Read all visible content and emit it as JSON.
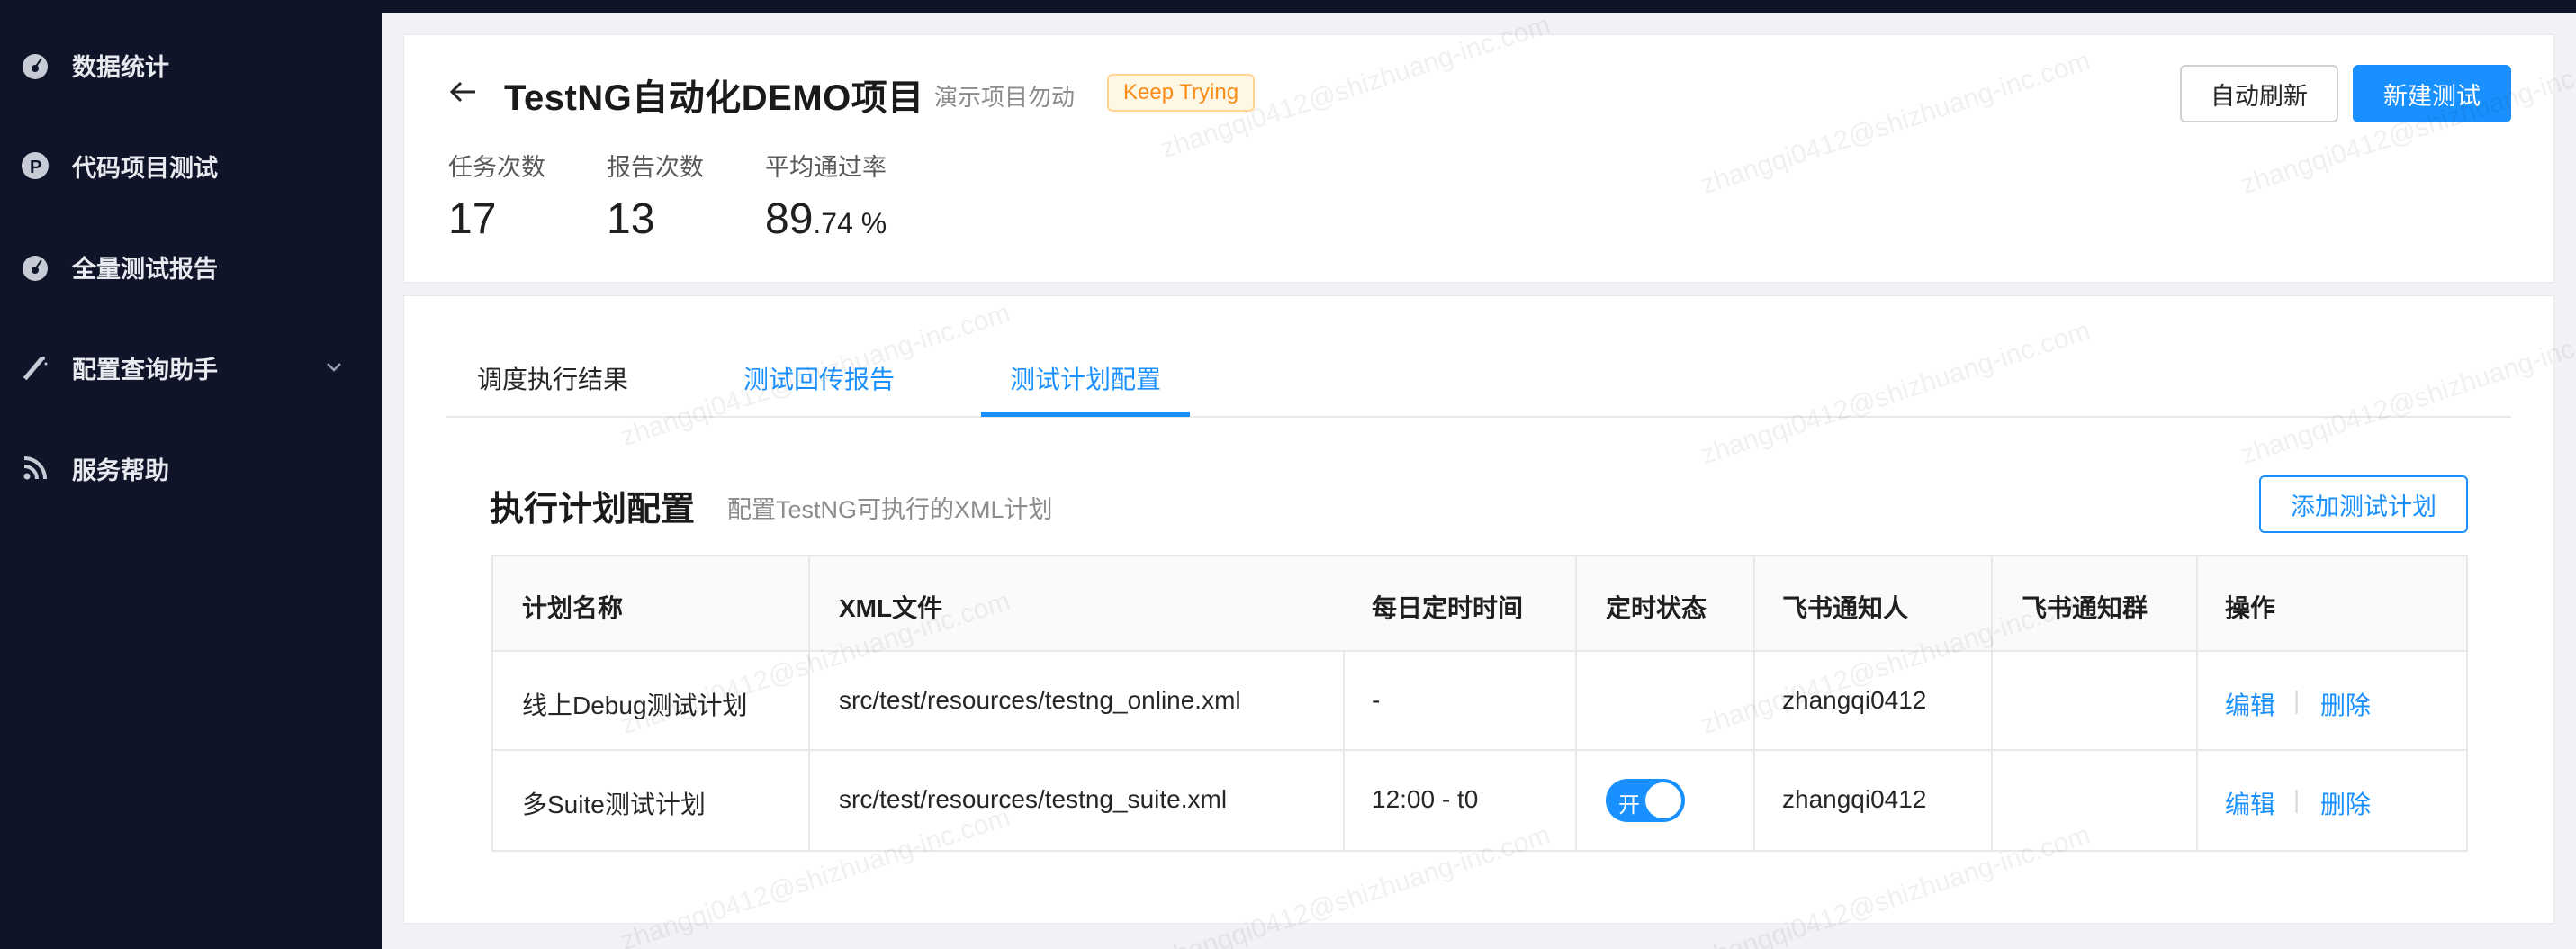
{
  "sidebar": {
    "items": [
      {
        "label": "数据统计",
        "icon": "dashboard-icon"
      },
      {
        "label": "代码项目测试",
        "icon": "p-circle-icon"
      },
      {
        "label": "全量测试报告",
        "icon": "dashboard-icon"
      },
      {
        "label": "配置查询助手",
        "icon": "magic-wand-icon"
      },
      {
        "label": "服务帮助",
        "icon": "rss-icon"
      }
    ]
  },
  "header": {
    "title": "TestNG自动化DEMO项目",
    "subtitle": "演示项目勿动",
    "tag": "Keep Trying",
    "auto_refresh_label": "自动刷新",
    "new_test_label": "新建测试",
    "stats": [
      {
        "label": "任务次数",
        "value": "17"
      },
      {
        "label": "报告次数",
        "value": "13"
      },
      {
        "label": "平均通过率",
        "value_int": "89",
        "value_dec": ".74 %"
      }
    ]
  },
  "tabs": [
    {
      "label": "调度执行结果",
      "active": false
    },
    {
      "label": "测试回传报告",
      "active": false
    },
    {
      "label": "测试计划配置",
      "active": true
    }
  ],
  "section": {
    "title": "执行计划配置",
    "desc": "配置TestNG可执行的XML计划",
    "add_button": "添加测试计划"
  },
  "table": {
    "columns": [
      "计划名称",
      "XML文件",
      "每日定时时间",
      "定时状态",
      "飞书通知人",
      "飞书通知群",
      "操作"
    ],
    "rows": [
      {
        "name": "线上Debug测试计划",
        "xml": "src/test/resources/testng_online.xml",
        "time": "-",
        "status": "",
        "notifier": "zhangqi0412",
        "group": "",
        "edit": "编辑",
        "delete": "删除"
      },
      {
        "name": "多Suite测试计划",
        "xml": "src/test/resources/testng_suite.xml",
        "time": "12:00 - t0",
        "status": "开",
        "notifier": "zhangqi0412",
        "group": "",
        "edit": "编辑",
        "delete": "删除"
      }
    ]
  },
  "watermark": "zhangqi0412@shizhuang-inc.com",
  "colors": {
    "accent": "#1890ff",
    "sidebar": "#0f1428",
    "tag_text": "#fa8c16"
  }
}
